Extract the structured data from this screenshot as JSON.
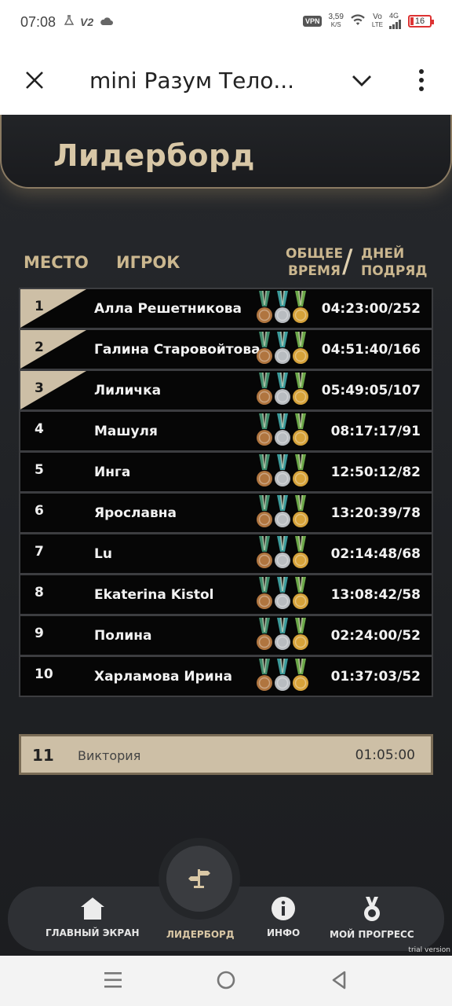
{
  "status_bar": {
    "time": "07:08",
    "left_icons": [
      "flask-icon",
      "v2-icon",
      "cloud-icon"
    ],
    "v2_label": "V2",
    "vpn": "VPN",
    "speed_value": "3,59",
    "speed_unit": "K/S",
    "network_top": "Vo",
    "network_bottom": "LTE",
    "signal_label": "4G",
    "battery": "16"
  },
  "title_bar": {
    "title": "mini Разум Тело..."
  },
  "app": {
    "page_title": "Лидерборд",
    "columns": {
      "place": "МЕСТО",
      "player": "ИГРОК",
      "total_line1": "ОБЩЕЕ",
      "total_line2": "ВРЕМЯ",
      "slash": "/",
      "days_line1": "ДНЕЙ",
      "days_line2": "ПОДРЯД"
    },
    "rows": [
      {
        "rank": "1",
        "name": "Алла Решетникова",
        "score": "04:23:00/252",
        "top": true
      },
      {
        "rank": "2",
        "name": "Галина Старовойтова",
        "score": "04:51:40/166",
        "top": true
      },
      {
        "rank": "3",
        "name": "Лиличка",
        "score": "05:49:05/107",
        "top": true
      },
      {
        "rank": "4",
        "name": "Машуля",
        "score": "08:17:17/91",
        "top": false
      },
      {
        "rank": "5",
        "name": "Инга",
        "score": "12:50:12/82",
        "top": false
      },
      {
        "rank": "6",
        "name": "Ярославна",
        "score": "13:20:39/78",
        "top": false
      },
      {
        "rank": "7",
        "name": "Lu",
        "score": "02:14:48/68",
        "top": false
      },
      {
        "rank": "8",
        "name": "Ekaterina Kistol",
        "score": "13:08:42/58",
        "top": false
      },
      {
        "rank": "9",
        "name": "Полина",
        "score": "02:24:00/52",
        "top": false
      },
      {
        "rank": "10",
        "name": "Харламова Ирина",
        "score": "01:37:03/52",
        "top": false
      }
    ],
    "my_row": {
      "rank": "11",
      "name": "Виктория",
      "time": "01:05:00"
    },
    "medal_colors": {
      "bronze": "#b0753f",
      "silver": "#b8bcc0",
      "gold": "#d6a23a",
      "ribbon_bronze": "#3f8a6a",
      "ribbon_silver": "#3c9a9a",
      "ribbon_gold": "#6aa648"
    },
    "accent_color": "#d8c7a6"
  },
  "nav": {
    "items": [
      {
        "label": "ГЛАВНЫЙ ЭКРАН",
        "icon": "home-icon"
      },
      {
        "label": "ЛИДЕРБОРД",
        "icon": "signpost-icon",
        "active": true
      },
      {
        "label": "ИНФО",
        "icon": "info-icon"
      },
      {
        "label": "МОЙ ПРОГРЕСС",
        "icon": "medal-icon"
      }
    ],
    "trial_text": "trial version"
  },
  "system_nav": {
    "buttons": [
      "menu-icon",
      "home-circle-icon",
      "back-icon"
    ]
  }
}
